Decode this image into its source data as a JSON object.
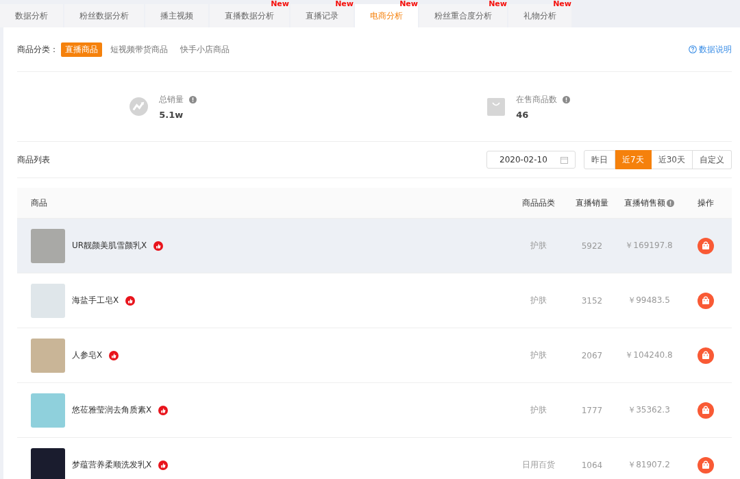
{
  "tabs": [
    {
      "label": "数据分析",
      "selected": false
    },
    {
      "label": "粉丝数据分析",
      "selected": false
    },
    {
      "label": "播主视频",
      "selected": false
    },
    {
      "label": "直播数据分析",
      "selected": false,
      "badge": "New"
    },
    {
      "label": "直播记录",
      "selected": false,
      "badge": "New"
    },
    {
      "label": "电商分析",
      "selected": true,
      "badge": "New"
    },
    {
      "label": "粉丝重合度分析",
      "selected": false,
      "badge": "New"
    },
    {
      "label": "礼物分析",
      "selected": false,
      "badge": "New"
    }
  ],
  "category_filter": {
    "label": "商品分类：",
    "options": [
      {
        "label": "直播商品",
        "selected": true
      },
      {
        "label": "短视频带货商品",
        "selected": false
      },
      {
        "label": "快手小店商品",
        "selected": false
      }
    ]
  },
  "help_link": "数据说明",
  "stats": [
    {
      "kind": "trend",
      "label": "总销量",
      "value": "5.1w"
    },
    {
      "kind": "bag",
      "label": "在售商品数",
      "value": "46"
    }
  ],
  "list_title": "商品列表",
  "date_field": {
    "value": "2020-02-10"
  },
  "ranges": [
    {
      "label": "昨日",
      "selected": false
    },
    {
      "label": "近7天",
      "selected": true
    },
    {
      "label": "近30天",
      "selected": false
    },
    {
      "label": "自定义",
      "selected": false
    }
  ],
  "table": {
    "columns": [
      "商品",
      "商品品类",
      "直播销量",
      "直播销售额",
      "操作"
    ],
    "rows": [
      {
        "name": "UR靓颜美肌雪颜乳X",
        "category": "护肤",
        "sales": "5922",
        "amount": "￥169197.8",
        "selected": true
      },
      {
        "name": "海盐手工皂X",
        "category": "护肤",
        "sales": "3152",
        "amount": "￥99483.5",
        "selected": false
      },
      {
        "name": "人参皂X",
        "category": "护肤",
        "sales": "2067",
        "amount": "￥104240.8",
        "selected": false
      },
      {
        "name": "悠莅雅莹润去角质素X",
        "category": "护肤",
        "sales": "1777",
        "amount": "￥35362.3",
        "selected": false
      },
      {
        "name": "梦蕴营养柔顺洗发乳X",
        "category": "日用百货",
        "sales": "1064",
        "amount": "￥81907.2",
        "selected": false
      }
    ]
  }
}
